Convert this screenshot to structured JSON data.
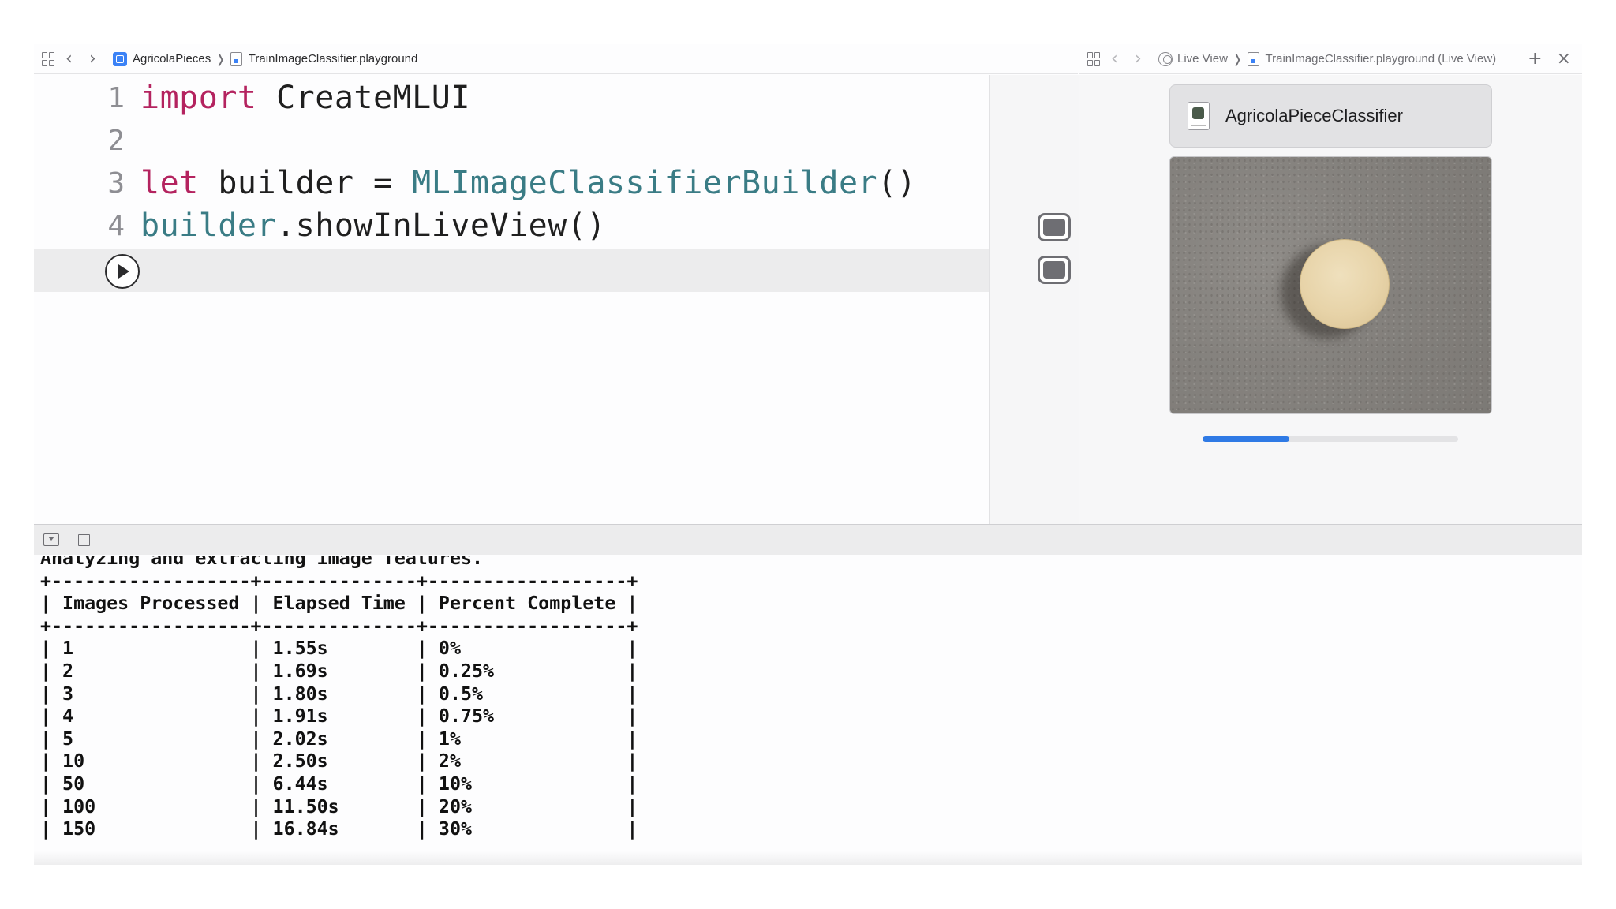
{
  "left_jumpbar": {
    "project": "AgricolaPieces",
    "file": "TrainImageClassifier.playground"
  },
  "right_jumpbar": {
    "mode": "Live View",
    "file": "TrainImageClassifier.playground (Live View)"
  },
  "editor": {
    "lines": [
      {
        "number": "1",
        "tokens": [
          {
            "text": "import",
            "style": "kw"
          },
          {
            "text": " CreateMLUI",
            "style": "plain"
          }
        ]
      },
      {
        "number": "2",
        "tokens": []
      },
      {
        "number": "3",
        "tokens": [
          {
            "text": "let",
            "style": "kw"
          },
          {
            "text": " builder = ",
            "style": "plain"
          },
          {
            "text": "MLImageClassifierBuilder",
            "style": "type"
          },
          {
            "text": "()",
            "style": "plain"
          }
        ]
      },
      {
        "number": "4",
        "tokens": [
          {
            "text": "builder",
            "style": "ident"
          },
          {
            "text": ".showInLiveView()",
            "style": "plain"
          }
        ]
      }
    ]
  },
  "live_view": {
    "model_name": "AgricolaPieceClassifier",
    "model_icon": "mlmodel-file-icon",
    "progress_fraction": 0.34
  },
  "console": {
    "status": "Analyzing and extracting image features.",
    "table": {
      "headers": [
        "Images Processed",
        "Elapsed Time",
        "Percent Complete"
      ],
      "rows": [
        [
          "1",
          "1.55s",
          "0%"
        ],
        [
          "2",
          "1.69s",
          "0.25%"
        ],
        [
          "3",
          "1.80s",
          "0.5%"
        ],
        [
          "4",
          "1.91s",
          "0.75%"
        ],
        [
          "5",
          "2.02s",
          "1%"
        ],
        [
          "10",
          "2.50s",
          "2%"
        ],
        [
          "50",
          "6.44s",
          "10%"
        ],
        [
          "100",
          "11.50s",
          "20%"
        ],
        [
          "150",
          "16.84s",
          "30%"
        ]
      ]
    }
  },
  "colors": {
    "keyword": "#b4235f",
    "type": "#3a7c85",
    "accent_progress": "#2f7ae5"
  }
}
